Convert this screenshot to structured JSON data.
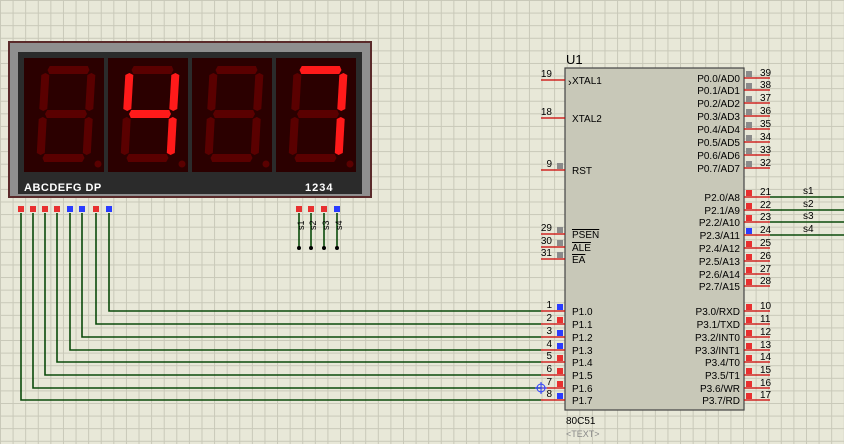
{
  "display": {
    "segment_labels": "ABCDEFG DP",
    "digit_labels": "1234",
    "digits": [
      "",
      "4",
      "",
      "7"
    ],
    "select_pins": [
      "s1",
      "s2",
      "s3",
      "s4"
    ],
    "segment_pin_colors": [
      "red",
      "red",
      "red",
      "red",
      "blue",
      "blue",
      "red",
      "blue"
    ],
    "select_pin_colors": [
      "red",
      "red",
      "red",
      "blue"
    ],
    "colors": {
      "frame": "#8f8f8f",
      "body": "#2b2b2b",
      "seg_on": "#ff1a1a",
      "seg_off": "#5a0000",
      "panel": "#2b0000"
    }
  },
  "chip": {
    "ref": "U1",
    "part": "80C51",
    "text_placeholder": "<TEXT>",
    "left_pins": [
      {
        "num": "19",
        "name": "XTAL1",
        "color": "none"
      },
      {
        "num": "18",
        "name": "XTAL2",
        "color": "none"
      },
      {
        "num": "9",
        "name": "RST",
        "color": "gray"
      },
      {
        "num": "29",
        "name": "PSEN",
        "color": "gray",
        "overline": true
      },
      {
        "num": "30",
        "name": "ALE",
        "color": "gray",
        "overline": true
      },
      {
        "num": "31",
        "name": "EA",
        "color": "gray",
        "overline": true
      },
      {
        "num": "1",
        "name": "P1.0",
        "color": "blue"
      },
      {
        "num": "2",
        "name": "P1.1",
        "color": "red"
      },
      {
        "num": "3",
        "name": "P1.2",
        "color": "blue"
      },
      {
        "num": "4",
        "name": "P1.3",
        "color": "blue"
      },
      {
        "num": "5",
        "name": "P1.4",
        "color": "red"
      },
      {
        "num": "6",
        "name": "P1.5",
        "color": "red"
      },
      {
        "num": "7",
        "name": "P1.6",
        "color": "red"
      },
      {
        "num": "8",
        "name": "P1.7",
        "color": "blue"
      }
    ],
    "right_pins": [
      {
        "num": "39",
        "name": "P0.0/AD0",
        "color": "gray"
      },
      {
        "num": "38",
        "name": "P0.1/AD1",
        "color": "gray"
      },
      {
        "num": "37",
        "name": "P0.2/AD2",
        "color": "gray"
      },
      {
        "num": "36",
        "name": "P0.3/AD3",
        "color": "gray"
      },
      {
        "num": "35",
        "name": "P0.4/AD4",
        "color": "gray"
      },
      {
        "num": "34",
        "name": "P0.5/AD5",
        "color": "gray"
      },
      {
        "num": "33",
        "name": "P0.6/AD6",
        "color": "gray"
      },
      {
        "num": "32",
        "name": "P0.7/AD7",
        "color": "gray"
      },
      {
        "num": "21",
        "name": "P2.0/A8",
        "color": "red"
      },
      {
        "num": "22",
        "name": "P2.1/A9",
        "color": "red"
      },
      {
        "num": "23",
        "name": "P2.2/A10",
        "color": "red"
      },
      {
        "num": "24",
        "name": "P2.3/A11",
        "color": "blue"
      },
      {
        "num": "25",
        "name": "P2.4/A12",
        "color": "red"
      },
      {
        "num": "26",
        "name": "P2.5/A13",
        "color": "red"
      },
      {
        "num": "27",
        "name": "P2.6/A14",
        "color": "red"
      },
      {
        "num": "28",
        "name": "P2.7/A15",
        "color": "red"
      },
      {
        "num": "10",
        "name": "P3.0/RXD",
        "color": "red"
      },
      {
        "num": "11",
        "name": "P3.1/TXD",
        "color": "red"
      },
      {
        "num": "12",
        "name": "P3.2/INT0",
        "color": "red"
      },
      {
        "num": "13",
        "name": "P3.3/INT1",
        "color": "red"
      },
      {
        "num": "14",
        "name": "P3.4/T0",
        "color": "red"
      },
      {
        "num": "15",
        "name": "P3.5/T1",
        "color": "red"
      },
      {
        "num": "16",
        "name": "P3.6/WR",
        "color": "red"
      },
      {
        "num": "17",
        "name": "P3.7/RD",
        "color": "red"
      }
    ],
    "net_labels": [
      "s1",
      "s2",
      "s3",
      "s4"
    ]
  }
}
